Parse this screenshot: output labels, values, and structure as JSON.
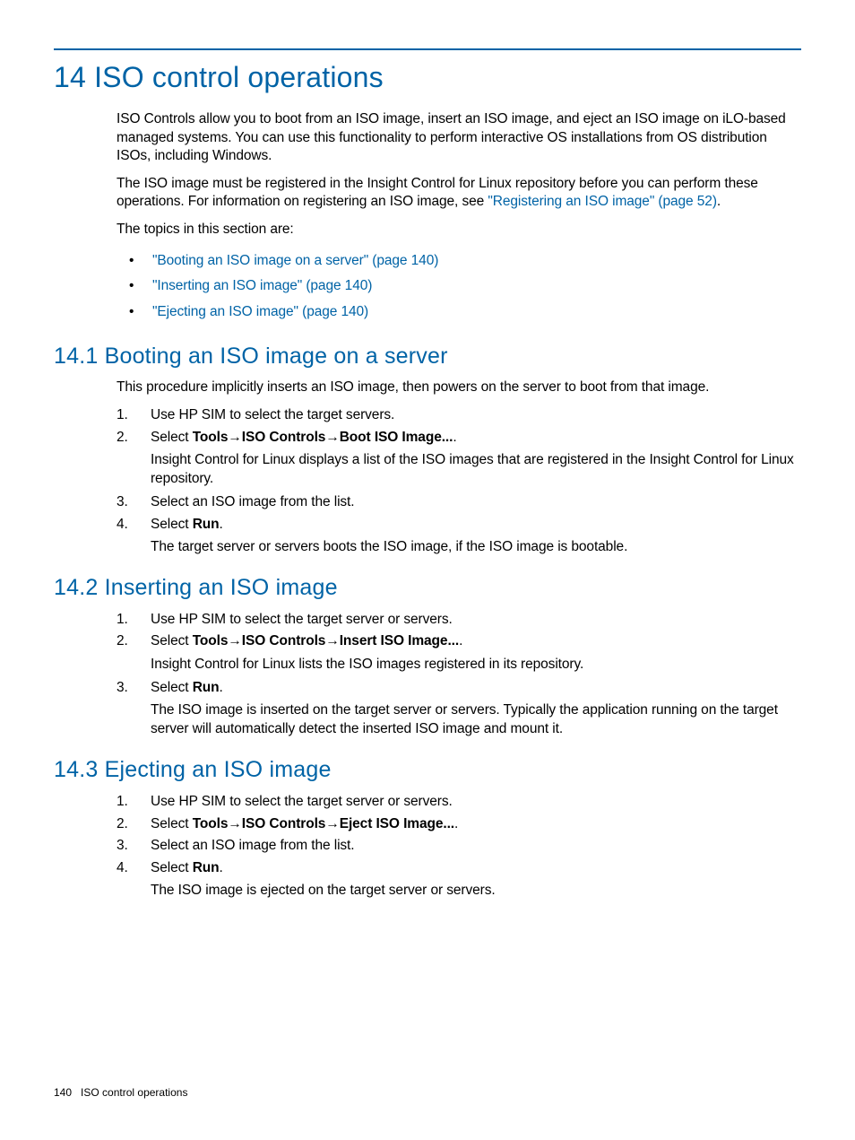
{
  "h1": "14 ISO control operations",
  "intro_p1": "ISO Controls allow you to boot from an ISO image, insert an ISO image, and eject an ISO image on iLO-based managed systems. You can use this functionality to perform interactive OS installations from OS distribution ISOs, including Windows.",
  "intro_p2a": "The ISO image must be registered in the Insight Control for Linux repository before you can perform these operations. For information on registering an ISO image, see ",
  "intro_p2_link": "\"Registering an ISO image\" (page 52)",
  "intro_p2b": ".",
  "topics_label": "The topics in this section are:",
  "topics": [
    "\"Booting an ISO image on a server\" (page 140)",
    "\"Inserting an ISO image\" (page 140)",
    "\"Ejecting an ISO image\" (page 140)"
  ],
  "s1": {
    "title": "14.1 Booting an ISO image on a server",
    "intro": "This procedure implicitly inserts an ISO image, then powers on the server to boot from that image.",
    "steps": {
      "s1": "Use HP SIM to select the target servers.",
      "s2a": "Select ",
      "s2b": "Tools",
      "s2c": "ISO Controls",
      "s2d": "Boot ISO Image...",
      "s2e": ".",
      "s2sub": "Insight Control for Linux displays a list of the ISO images that are registered in the Insight Control for Linux repository.",
      "s3": "Select an ISO image from the list.",
      "s4a": "Select ",
      "s4b": "Run",
      "s4c": ".",
      "s4sub": "The target server or servers boots the ISO image, if the ISO image is bootable."
    }
  },
  "s2": {
    "title": "14.2 Inserting an ISO image",
    "steps": {
      "s1": "Use HP SIM to select the target server or servers.",
      "s2a": "Select ",
      "s2b": "Tools",
      "s2c": "ISO Controls",
      "s2d": "Insert ISO Image...",
      "s2e": ".",
      "s2sub": "Insight Control for Linux lists the ISO images registered in its repository.",
      "s3a": "Select ",
      "s3b": "Run",
      "s3c": ".",
      "s3sub": "The ISO image is inserted on the target server or servers. Typically the application running on the target server will automatically detect the inserted ISO image and mount it."
    }
  },
  "s3": {
    "title": "14.3 Ejecting an ISO image",
    "steps": {
      "s1": "Use HP SIM to select the target server or servers.",
      "s2a": "Select ",
      "s2b": "Tools",
      "s2c": "ISO Controls",
      "s2d": "Eject ISO Image...",
      "s2e": ".",
      "s3": "Select an ISO image from the list.",
      "s4a": "Select ",
      "s4b": "Run",
      "s4c": ".",
      "s4sub": "The ISO image is ejected on the target server or servers."
    }
  },
  "footer": {
    "pagenum": "140",
    "title": "ISO control operations"
  }
}
